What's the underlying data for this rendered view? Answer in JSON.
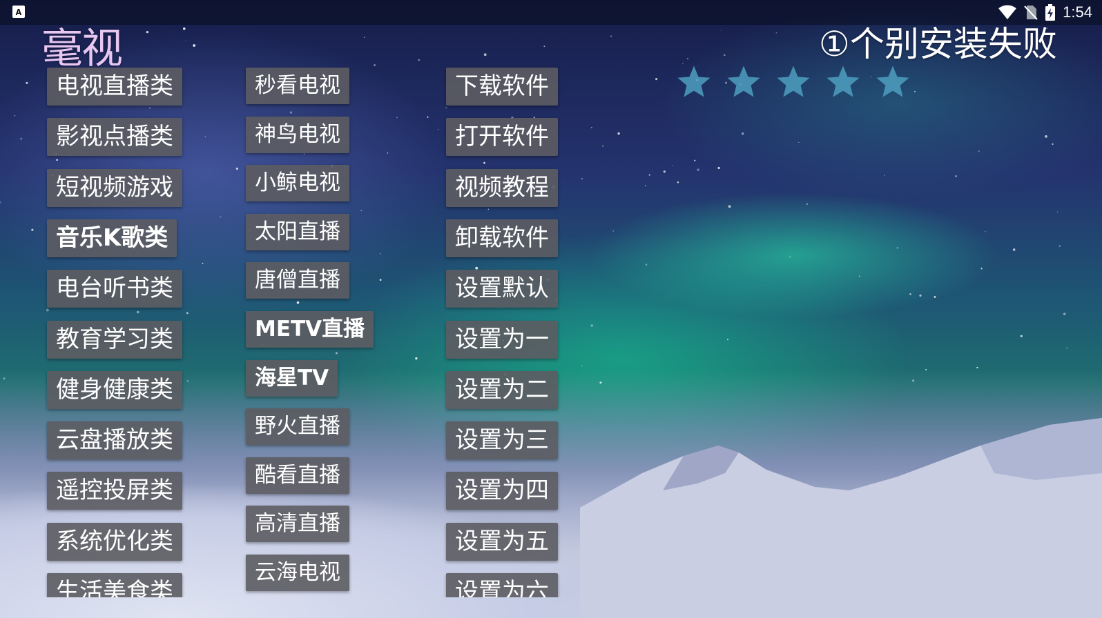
{
  "status_bar": {
    "app_indicator": "A",
    "time": "1:54",
    "icons": [
      "wifi-icon",
      "no-sim-icon",
      "battery-charging-icon"
    ]
  },
  "logo": {
    "text": "毫视"
  },
  "marquee": {
    "text": "①个别安装失败"
  },
  "rating": {
    "stars": 5,
    "filled": 5,
    "color": "#4d9fc0"
  },
  "columns": {
    "categories": [
      "电视直播类",
      "影视点播类",
      "短视频游戏",
      "音乐K歌类",
      "电台听书类",
      "教育学习类",
      "健身健康类",
      "云盘播放类",
      "遥控投屏类",
      "系统优化类",
      "生活美食类"
    ],
    "apps": [
      "秒看电视",
      "神鸟电视",
      "小鲸电视",
      "太阳直播",
      "唐僧直播",
      "METV直播",
      "海星TV",
      "野火直播",
      "酷看直播",
      "高清直播",
      "云海电视"
    ],
    "actions": [
      "下载软件",
      "打开软件",
      "视频教程",
      "卸载软件",
      "设置默认",
      "设置为一",
      "设置为二",
      "设置为三",
      "设置为四",
      "设置为五",
      "设置为六"
    ]
  },
  "colors": {
    "button_bg": "#5c5c62",
    "logo": "#e7c6f0",
    "star": "#4d9fc0"
  }
}
